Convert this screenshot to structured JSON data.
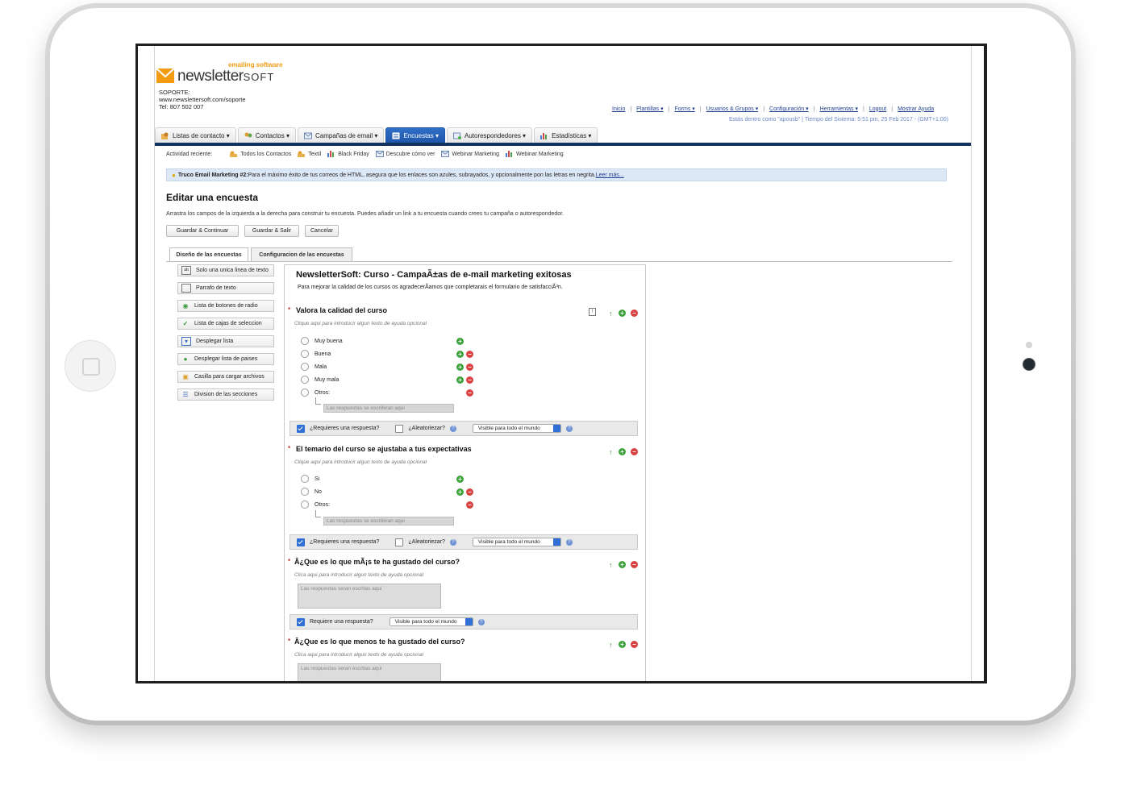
{
  "logo": {
    "tagline": "emailing software",
    "name": "newsletter",
    "name_suffix": "SOFT"
  },
  "support": {
    "label": "SOPORTE:",
    "url": "www.newslettersoft.com/soporte",
    "phone": "Tel: 807 502 007"
  },
  "top_nav": [
    "Inicio",
    "Plantillas ▾",
    "Forms ▾",
    "Usuarios & Grupos ▾",
    "Configuración ▾",
    "Herramientas ▾",
    "Logout",
    "Mostrar Ayuda"
  ],
  "status": "Estás dentro como \"apousb\" | Tiempo del Sistema: 5:51 pm, 25 Feb 2017 - (GMT+1:00)",
  "main_tabs": [
    {
      "label": "Listas de contacto ▾",
      "icon": "contact-list-icon"
    },
    {
      "label": "Contactos ▾",
      "icon": "contacts-icon"
    },
    {
      "label": "Campañas de email ▾",
      "icon": "email-icon"
    },
    {
      "label": "Encuestas ▾",
      "icon": "survey-icon",
      "active": true
    },
    {
      "label": "Autorespondedores ▾",
      "icon": "autoresponder-icon"
    },
    {
      "label": "Estadísticas ▾",
      "icon": "stats-icon"
    }
  ],
  "recent": {
    "label": "Actividad reciente:",
    "items": [
      {
        "label": "Todos los Contactos",
        "icon": "contacts-icon"
      },
      {
        "label": "Textil",
        "icon": "contacts-icon"
      },
      {
        "label": "Black Friday",
        "icon": "stats-icon"
      },
      {
        "label": "Descubre cómo ver",
        "icon": "email-icon"
      },
      {
        "label": "Webinar Marketing",
        "icon": "email-icon"
      },
      {
        "label": "Webinar Marketing",
        "icon": "stats-icon"
      }
    ]
  },
  "tip": {
    "bold": "Truco Email Marketing #2:",
    "text": " Para el máximo éxito de tus correos de HTML, asegura que los enlaces son azules, subrayados, y opcionalmente pon las letras en negrita. ",
    "link": "Leer más..."
  },
  "page": {
    "title": "Editar una encuesta",
    "description": "Arrastra los campos de la izquierda a la derecha para construir tu encuesta. Puedes añadir un link a tu encuesta cuando crees tu campaña o autorespondedor."
  },
  "buttons": {
    "save_continue": "Guardar & Continuar",
    "save_exit": "Guardar & Salir",
    "cancel": "Cancelar"
  },
  "sub_tabs": [
    "Diseño de las encuestas",
    "Configuracion de las encuestas"
  ],
  "fields": [
    {
      "label": "Solo una unica linea de texto",
      "icon": "text-line-icon"
    },
    {
      "label": "Parrafo de texto",
      "icon": "paragraph-icon"
    },
    {
      "label": "Lista de botones de radio",
      "icon": "radio-icon"
    },
    {
      "label": "Lista de cajas de seleccion",
      "icon": "checkbox-icon"
    },
    {
      "label": "Desplegar lista",
      "icon": "dropdown-icon"
    },
    {
      "label": "Desplegar lista de paises",
      "icon": "globe-icon"
    },
    {
      "label": "Casilla para cargar archivos",
      "icon": "upload-icon"
    },
    {
      "label": "Division de las secciones",
      "icon": "section-icon"
    }
  ],
  "survey": {
    "title": "NewsletterSoft: Curso - CampaÃ±as de e-mail marketing exitosas",
    "subtitle": "Para mejorar la calidad de los cursos os agradecerÃamos que completarais el formulario de satisfacciÃ³n.",
    "q1": {
      "title": "Valora la calidad del curso",
      "help": "Clique aqui para introducir algun texto de ayuda opcional",
      "options": [
        "Muy buena",
        "Buena",
        "Mala",
        "Muy mala",
        "Otros:"
      ],
      "other_placeholder": "Las respuestas se escribiran aqui"
    },
    "q2": {
      "title": "El temario del curso se ajustaba a tus expectativas",
      "help": "Clique aqui para introducir algun texto de ayuda opcional",
      "options": [
        "Si",
        "No",
        "Otros:"
      ],
      "other_placeholder": "Las respuestas se escribiran aqui"
    },
    "q3": {
      "title": "Â¿Que es lo que mÃ¡s te ha gustado del curso?",
      "help": "Clica aqui para introducir algun texto de ayuda opcional",
      "placeholder": "Las respuestas seran escritas aqui"
    },
    "q4": {
      "title": "Â¿Que es lo que menos te ha gustado del curso?",
      "help": "Clica aqui para introducir algun texto de ayuda opcional",
      "placeholder": "Las respuestas seran escritas aqui"
    },
    "required_label": "¿Requieres una respuesta?",
    "required_label_2": "Requiere una respuesta?",
    "randomize_label": "¿Aleatoriezar?",
    "visibility": "Visible para todo el mundo"
  },
  "colors": {
    "active_tab": "#1f55a8",
    "nav_bar": "#13335f",
    "tip_bg": "#dde8f7",
    "add": "#3da33d",
    "remove": "#d94040"
  }
}
